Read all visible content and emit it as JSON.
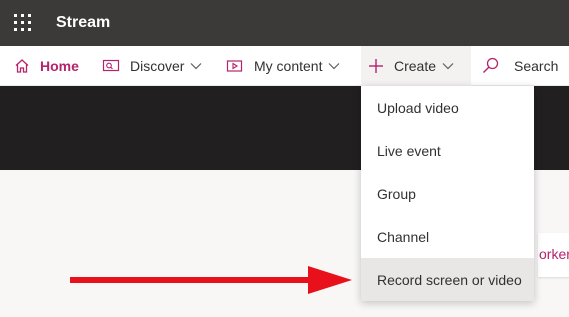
{
  "app": {
    "title": "Stream"
  },
  "nav": {
    "home": "Home",
    "discover": "Discover",
    "my_content": "My content",
    "create": "Create",
    "search": "Search"
  },
  "create_menu": {
    "items": [
      {
        "label": "Upload video"
      },
      {
        "label": "Live event"
      },
      {
        "label": "Group"
      },
      {
        "label": "Channel"
      },
      {
        "label": "Record screen or video"
      }
    ]
  },
  "page": {
    "partial_text": "orker"
  },
  "colors": {
    "accent": "#b4236b",
    "topbar": "#3b3a39",
    "hero": "#211f1f",
    "arrow": "#e8101a"
  }
}
